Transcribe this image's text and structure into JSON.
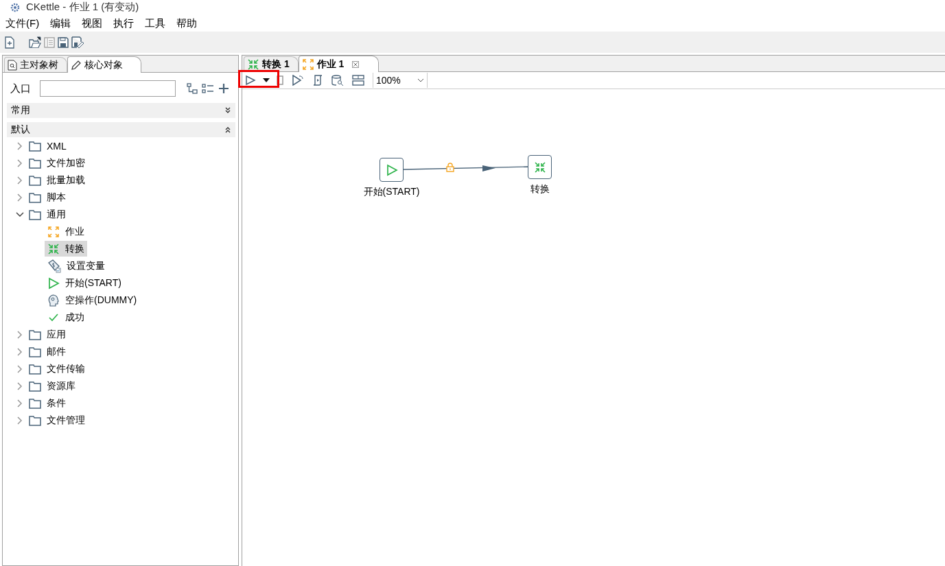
{
  "window": {
    "title": "CKettle - 作业 1 (有变动)"
  },
  "menu": [
    "文件(F)",
    "编辑",
    "视图",
    "执行",
    "工具",
    "帮助"
  ],
  "left_panel": {
    "tabs": [
      {
        "label": "主对象树",
        "kind": "tree",
        "selected": false
      },
      {
        "label": "核心对象",
        "kind": "core",
        "selected": true
      }
    ],
    "search_label": "入口",
    "sections": [
      {
        "label": "常用",
        "expanded": false
      },
      {
        "label": "默认",
        "expanded": true
      }
    ],
    "tree": [
      {
        "label": "XML",
        "expanded": false
      },
      {
        "label": "文件加密",
        "expanded": false
      },
      {
        "label": "批量加载",
        "expanded": false
      },
      {
        "label": "脚本",
        "expanded": false
      },
      {
        "label": "通用",
        "expanded": true,
        "children": [
          {
            "label": "作业",
            "kind": "job",
            "selected": false
          },
          {
            "label": "转换",
            "kind": "trans",
            "selected": true
          },
          {
            "label": "设置变量",
            "kind": "setvar",
            "selected": false
          },
          {
            "label": "开始(START)",
            "kind": "start",
            "selected": false
          },
          {
            "label": "空操作(DUMMY)",
            "kind": "dummy",
            "selected": false
          },
          {
            "label": "成功",
            "kind": "success",
            "selected": false
          }
        ]
      },
      {
        "label": "应用",
        "expanded": false
      },
      {
        "label": "邮件",
        "expanded": false
      },
      {
        "label": "文件传输",
        "expanded": false
      },
      {
        "label": "资源库",
        "expanded": false
      },
      {
        "label": "条件",
        "expanded": false
      },
      {
        "label": "文件管理",
        "expanded": false
      }
    ]
  },
  "editor": {
    "tabs": [
      {
        "label": "转换 1",
        "kind": "trans",
        "selected": false
      },
      {
        "label": "作业 1",
        "kind": "job",
        "selected": true
      }
    ],
    "run_highlighted": true,
    "zoom": "100%",
    "canvas": {
      "nodes": [
        {
          "label": "开始(START)",
          "kind": "start"
        },
        {
          "label": "转换",
          "kind": "trans"
        }
      ],
      "hops": [
        {
          "locked": true
        }
      ]
    }
  }
}
